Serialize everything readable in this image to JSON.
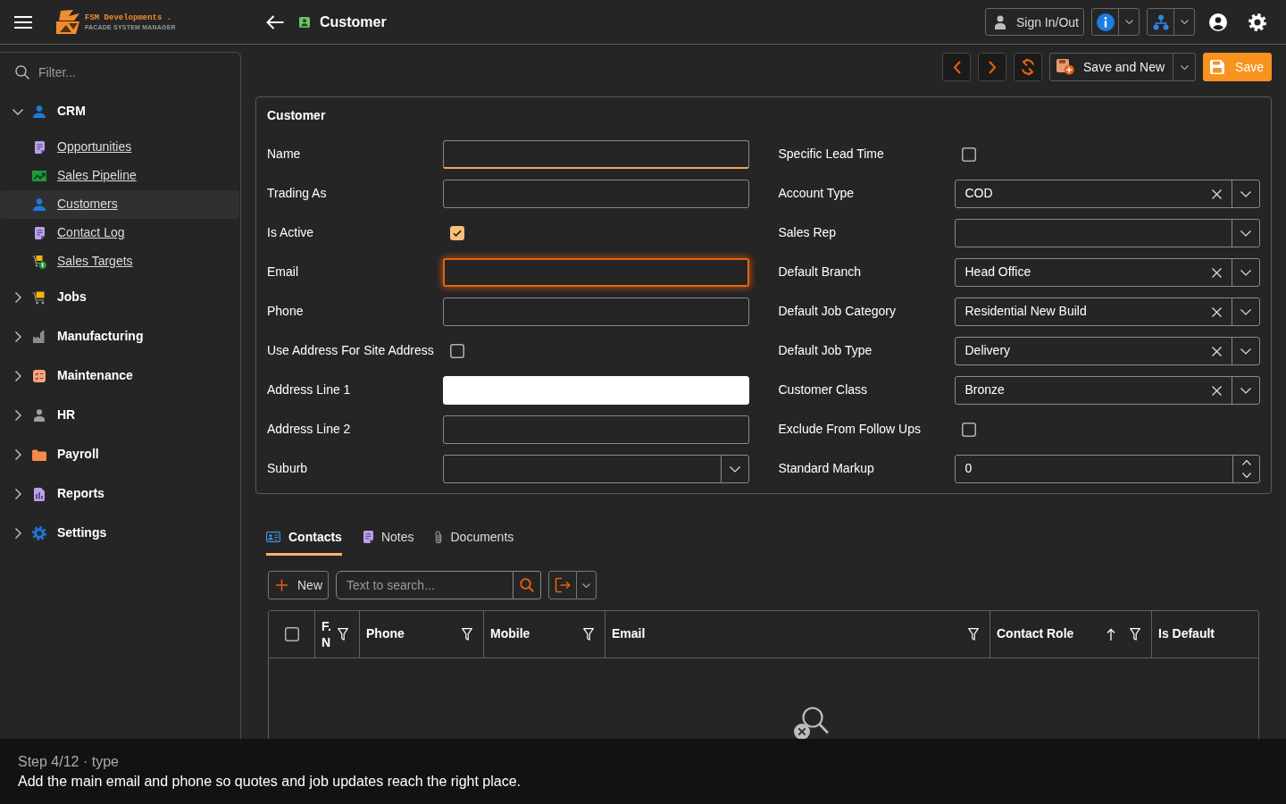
{
  "header": {
    "logo_name": "FSM Developments .",
    "logo_tagline": "FACADE SYSTEM MANAGER",
    "title": "Customer",
    "sign_in_out": "Sign In/Out"
  },
  "sidebar": {
    "filter": {
      "placeholder": "Filter..."
    },
    "items": [
      {
        "label": "CRM",
        "expanded": true,
        "children": [
          {
            "label": "Opportunities",
            "selected": false
          },
          {
            "label": "Sales Pipeline",
            "selected": false
          },
          {
            "label": "Customers",
            "selected": true
          },
          {
            "label": "Contact Log",
            "selected": false
          },
          {
            "label": "Sales Targets",
            "selected": false
          }
        ]
      },
      {
        "label": "Jobs",
        "expanded": false
      },
      {
        "label": "Manufacturing",
        "expanded": false
      },
      {
        "label": "Maintenance",
        "expanded": false
      },
      {
        "label": "HR",
        "expanded": false
      },
      {
        "label": "Payroll",
        "expanded": false
      },
      {
        "label": "Reports",
        "expanded": false
      },
      {
        "label": "Settings",
        "expanded": false
      }
    ]
  },
  "toolbar": {
    "save_and_new": "Save and New",
    "save": "Save"
  },
  "customer_form": {
    "title": "Customer",
    "left_fields": [
      {
        "kind": "text",
        "label": "Name",
        "required": true,
        "focused": false,
        "autofilled": false
      },
      {
        "kind": "text",
        "label": "Trading As",
        "required": false,
        "focused": false,
        "autofilled": false
      },
      {
        "kind": "checkbox",
        "label": "Is Active",
        "checked": true
      },
      {
        "kind": "text",
        "label": "Email",
        "required": false,
        "focused": true,
        "autofilled": false
      },
      {
        "kind": "text",
        "label": "Phone",
        "required": false,
        "focused": false,
        "autofilled": false
      },
      {
        "kind": "checkbox",
        "label": "Use Address For Site Address",
        "checked": false
      },
      {
        "kind": "text",
        "label": "Address Line 1",
        "required": false,
        "focused": false,
        "autofilled": true
      },
      {
        "kind": "text",
        "label": "Address Line 2",
        "required": false,
        "focused": false,
        "autofilled": false
      },
      {
        "kind": "select",
        "label": "Suburb"
      }
    ],
    "right_fields": [
      {
        "kind": "checkbox",
        "label": "Specific Lead Time",
        "checked": false
      },
      {
        "kind": "select",
        "label": "Account Type",
        "value": "COD"
      },
      {
        "kind": "select",
        "label": "Sales Rep"
      },
      {
        "kind": "select",
        "label": "Default Branch",
        "value": "Head Office"
      },
      {
        "kind": "select",
        "label": "Default Job Category",
        "value": "Residential New Build"
      },
      {
        "kind": "select",
        "label": "Default Job Type",
        "value": "Delivery"
      },
      {
        "kind": "select",
        "label": "Customer Class",
        "value": "Bronze"
      },
      {
        "kind": "checkbox",
        "label": "Exclude From Follow Ups",
        "checked": false
      },
      {
        "kind": "number",
        "label": "Standard Markup",
        "value": "0"
      }
    ]
  },
  "tabs": [
    {
      "label": "Contacts",
      "selected": true
    },
    {
      "label": "Notes",
      "selected": false
    },
    {
      "label": "Documents",
      "selected": false
    }
  ],
  "contacts_grid": {
    "new_button": "New",
    "search": {
      "placeholder": "Text to search..."
    },
    "select_all": {
      "checked": false
    },
    "columns": [
      {
        "label": "F. N",
        "filter": true,
        "sort_ascending": false
      },
      {
        "label": "Phone",
        "filter": true,
        "sort_ascending": false
      },
      {
        "label": "Mobile",
        "filter": true,
        "sort_ascending": false
      },
      {
        "label": "Email",
        "filter": true,
        "sort_ascending": false
      },
      {
        "label": "Contact Role",
        "filter": true,
        "sort_ascending": true
      },
      {
        "label": "Is Default",
        "filter": false,
        "sort_ascending": false
      }
    ]
  },
  "step_banner": {
    "step": "Step 4/12 · type",
    "message": "Add the main email and phone so quotes and job updates reach the right place."
  }
}
